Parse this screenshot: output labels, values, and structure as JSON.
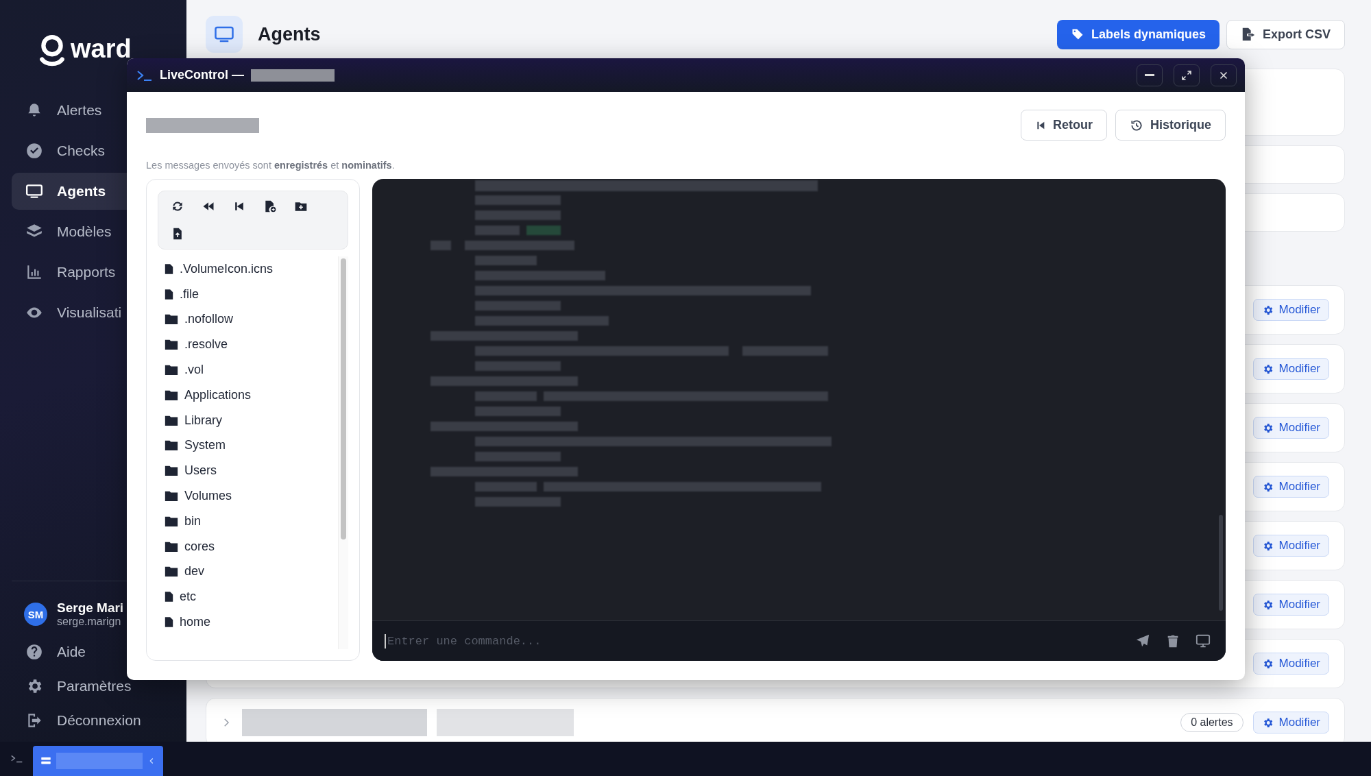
{
  "sidebar": {
    "brand": "ward",
    "items": [
      {
        "label": "Alertes",
        "selected": false
      },
      {
        "label": "Checks",
        "selected": false
      },
      {
        "label": "Agents",
        "selected": true
      },
      {
        "label": "Modèles",
        "selected": false
      },
      {
        "label": "Rapports",
        "selected": false
      },
      {
        "label": "Visualisati",
        "selected": false
      }
    ],
    "user": {
      "initials": "SM",
      "name": "Serge Mari",
      "email": "serge.marign"
    },
    "footer_items": [
      {
        "label": "Aide"
      },
      {
        "label": "Paramètres"
      },
      {
        "label": "Déconnexion"
      }
    ]
  },
  "header": {
    "title": "Agents",
    "buttons": [
      {
        "label": "Labels dynamiques",
        "kind": "primary"
      },
      {
        "label": "Export CSV",
        "kind": "secondary"
      }
    ]
  },
  "agents": [
    {
      "action": "Modifier"
    },
    {
      "action": "Modifier"
    },
    {
      "action": "Modifier"
    },
    {
      "action": "Modifier"
    },
    {
      "action": "Modifier"
    },
    {
      "action": "Modifier"
    },
    {
      "action": "Modifier"
    },
    {
      "action": "Modifier",
      "alerts": "0 alertes"
    }
  ],
  "live_control": {
    "title": "LiveControl —",
    "buttons": [
      {
        "label": "Retour"
      },
      {
        "label": "Historique"
      }
    ],
    "notice": "Les messages envoyés sont **enregistrés** et **nominatifs**.",
    "files": [
      {
        "name": ".VolumeIcon.icns",
        "kind": "file"
      },
      {
        "name": ".file",
        "kind": "file"
      },
      {
        "name": ".nofollow",
        "kind": "folder"
      },
      {
        "name": ".resolve",
        "kind": "folder"
      },
      {
        "name": ".vol",
        "kind": "folder"
      },
      {
        "name": "Applications",
        "kind": "folder"
      },
      {
        "name": "Library",
        "kind": "folder"
      },
      {
        "name": "System",
        "kind": "folder"
      },
      {
        "name": "Users",
        "kind": "folder"
      },
      {
        "name": "Volumes",
        "kind": "folder"
      },
      {
        "name": "bin",
        "kind": "folder"
      },
      {
        "name": "cores",
        "kind": "folder"
      },
      {
        "name": "dev",
        "kind": "folder"
      },
      {
        "name": "etc",
        "kind": "file"
      },
      {
        "name": "home",
        "kind": "file"
      }
    ],
    "command": {
      "placeholder": "Entrer une commande..."
    }
  }
}
